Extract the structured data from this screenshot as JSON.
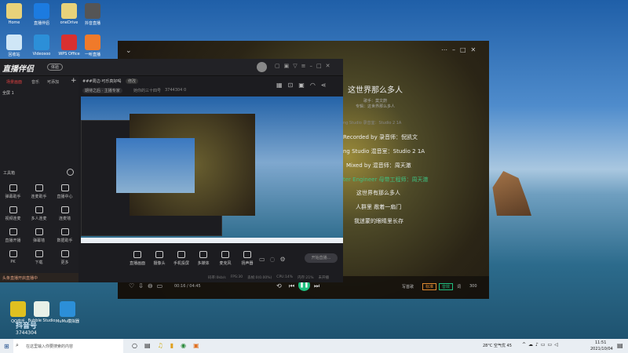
{
  "desktop": {
    "icons": [
      {
        "label": "Home",
        "color": "#e8d27a"
      },
      {
        "label": "直播伴侣",
        "color": "#1c7be0"
      },
      {
        "label": "oneDrive",
        "color": "#e8d27a"
      },
      {
        "label": "抖音直播",
        "color": "#555"
      },
      {
        "label": "回收站",
        "color": "#cfe6f6"
      },
      {
        "label": "Videosoo",
        "color": "#2c8fd8"
      },
      {
        "label": "WPS Office",
        "color": "#d83030"
      },
      {
        "label": "一听直播",
        "color": "#f07a2a"
      },
      {
        "label": "QQ音乐",
        "color": "#e0c020"
      },
      {
        "label": "Bubble Studio",
        "color": "#e8f0e8"
      },
      {
        "label": "MuMu模拟器",
        "color": "#2c8fd8"
      }
    ],
    "watermark": "抖音号",
    "watermark_id": "3744304"
  },
  "music": {
    "title": "这世界那么多人",
    "singer": "歌手：莫文蔚",
    "album": "专辑：这世界那么多人",
    "lyrics": [
      "ng Studio 录音室：Studio 2 1A",
      "Recorded by 录音师：倪凯文",
      "ng Studio 混音室：Studio 2 1A",
      "Mixed by 混音师：周天澈",
      "ter Engineer 母带工程师：周天澈",
      "这世界有那么多人",
      "人群里 敞着一扇门",
      "我迷蒙的眼睛里长存"
    ],
    "time": "00:16 / 04:45",
    "right_labels": [
      "写首歌",
      "标准",
      "音效",
      "词",
      "300"
    ],
    "accent": "#20c080"
  },
  "live": {
    "app_name": "直播伴侣",
    "version_badge": "体验",
    "side_tabs": [
      "场景画面",
      "音乐",
      "可添加"
    ],
    "scene": "全屏 1",
    "room_title": "###周边-可乐真好喝",
    "edit_label": "修改",
    "sub_tag": "期待之后 · 主播专家",
    "user_text": "她你的三十四号",
    "user_id": "3744304",
    "likes": "0",
    "toolbox_label": "工具箱",
    "tools": [
      "弹幕助手",
      "连麦助手",
      "直播中心",
      "视频连麦",
      "多人连麦",
      "连麦墙",
      "直播开播",
      "弹幕墙",
      "数据助手",
      "PK",
      "下载",
      "更多"
    ],
    "bottom_tools": [
      "直播画面",
      "摄像头",
      "手机投屏",
      "多媒体",
      "麦克风",
      "扬声器"
    ],
    "start_label": "开始直播...",
    "status": [
      "码率:0kb/s",
      "FPS:30",
      "丢帧:0(0.00%)",
      "CPU:14%",
      "内存:21%",
      "未开播"
    ],
    "notice": "头条直播开启直播中"
  },
  "taskbar": {
    "search_placeholder": "在这里输入你要搜索的内容",
    "weather": "28°C 空气优 45",
    "time": "11:51",
    "date": "2021/10/04"
  }
}
